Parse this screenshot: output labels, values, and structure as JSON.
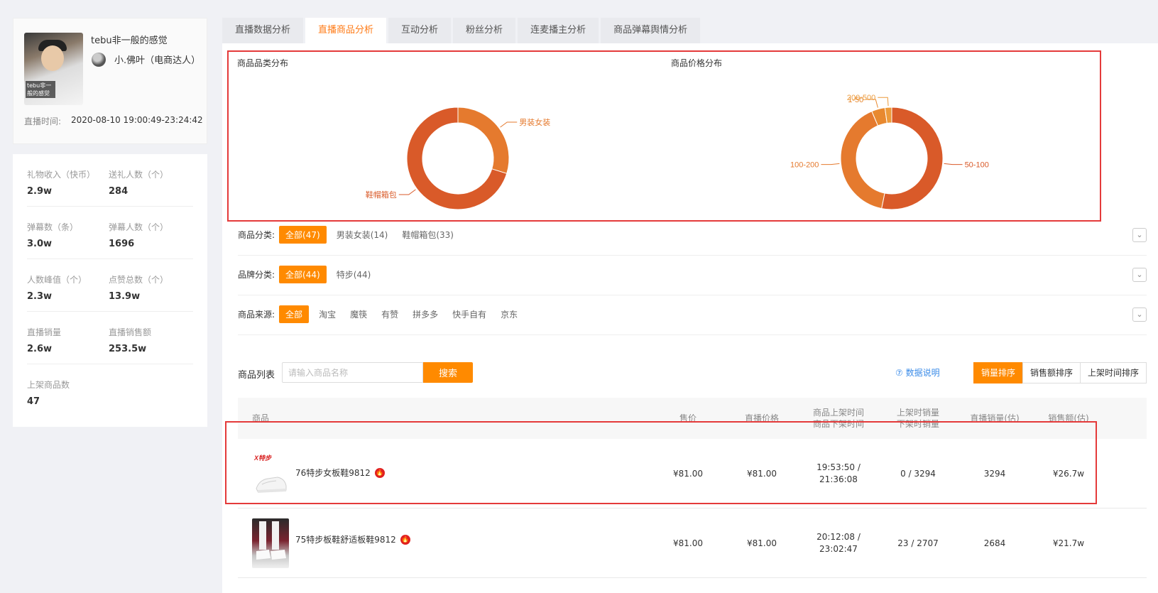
{
  "profile": {
    "name": "tebu非一般的感觉",
    "cover_caption": "tebu非一般的感觉",
    "author": "小.佛叶（电商达人）",
    "time_label": "直播时间:",
    "time_value": "2020-08-10 19:00:49-23:24:42"
  },
  "stats": [
    [
      {
        "label": "礼物收入（快币）",
        "value": "2.9w"
      },
      {
        "label": "送礼人数（个）",
        "value": "284"
      }
    ],
    [
      {
        "label": "弹幕数（条）",
        "value": "3.0w"
      },
      {
        "label": "弹幕人数（个）",
        "value": "1696"
      }
    ],
    [
      {
        "label": "人数峰值（个）",
        "value": "2.3w"
      },
      {
        "label": "点赞总数（个）",
        "value": "13.9w"
      }
    ],
    [
      {
        "label": "直播销量",
        "value": "2.6w"
      },
      {
        "label": "直播销售额",
        "value": "253.5w"
      }
    ],
    [
      {
        "label": "上架商品数",
        "value": "47"
      }
    ]
  ],
  "tabs": [
    "直播数据分析",
    "直播商品分析",
    "互动分析",
    "粉丝分析",
    "连麦播主分析",
    "商品弹幕舆情分析"
  ],
  "active_tab": 1,
  "chart_data": [
    {
      "type": "pie",
      "title": "商品品类分布",
      "categories": [
        "男装女装",
        "鞋帽箱包"
      ],
      "values": [
        14,
        33
      ],
      "colors": [
        "#e57a2e",
        "#d95a29"
      ]
    },
    {
      "type": "pie",
      "title": "商品价格分布",
      "categories": [
        "50-100",
        "100-200",
        "1-50",
        "200-500"
      ],
      "values": [
        25,
        19,
        2,
        1
      ],
      "colors": [
        "#d95a29",
        "#e57a2e",
        "#e8892f",
        "#ec9a3a"
      ]
    }
  ],
  "filters": {
    "category": {
      "label": "商品分类:",
      "items": [
        "全部(47)",
        "男装女装(14)",
        "鞋帽箱包(33)"
      ]
    },
    "brand": {
      "label": "品牌分类:",
      "items": [
        "全部(44)",
        "特步(44)"
      ]
    },
    "source": {
      "label": "商品来源:",
      "items": [
        "全部",
        "淘宝",
        "魔筷",
        "有赞",
        "拼多多",
        "快手自有",
        "京东"
      ]
    },
    "toggle_icon": "chevron-down-icon"
  },
  "list": {
    "title": "商品列表",
    "search_placeholder": "请输入商品名称",
    "search_label": "搜索",
    "help_label": "⑦ 数据说明",
    "sort": [
      "销量排序",
      "销售额排序",
      "上架时间排序"
    ]
  },
  "table": {
    "headers": {
      "product": "商品",
      "price": "售价",
      "live_price": "直播价格",
      "on_time": "商品上架时间",
      "off_time": "商品下架时间",
      "on_sales": "上架时销量",
      "off_sales": "下架时销量",
      "live_sales": "直播销量(估)",
      "revenue": "销售额(估)"
    },
    "rows": [
      {
        "name": "76特步女板鞋9812",
        "brand_mark": "X特步",
        "price": "¥81.00",
        "live_price": "¥81.00",
        "time_on": "19:53:50 /",
        "time_off": "21:36:08",
        "sales_change": "0 / 3294",
        "live_sales": "3294",
        "revenue": "¥26.7w"
      },
      {
        "name": "75特步板鞋舒适板鞋9812",
        "price": "¥81.00",
        "live_price": "¥81.00",
        "time_on": "20:12:08 /",
        "time_off": "23:02:47",
        "sales_change": "23 / 2707",
        "live_sales": "2684",
        "revenue": "¥21.7w"
      }
    ]
  }
}
